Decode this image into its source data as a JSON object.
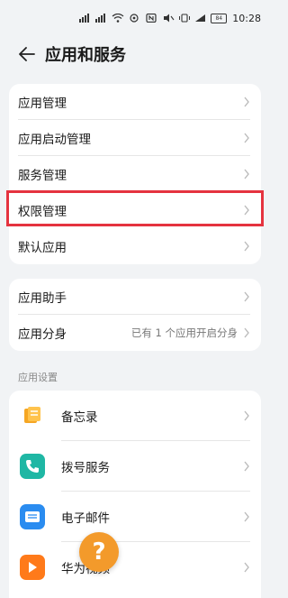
{
  "status_bar": {
    "time": "10:28",
    "battery": "84"
  },
  "header": {
    "title": "应用和服务",
    "back_icon": "arrow-left-icon"
  },
  "group1": {
    "items": [
      {
        "label": "应用管理"
      },
      {
        "label": "应用启动管理"
      },
      {
        "label": "服务管理"
      },
      {
        "label": "权限管理",
        "highlighted": true
      },
      {
        "label": "默认应用"
      }
    ]
  },
  "group2": {
    "items": [
      {
        "label": "应用助手"
      },
      {
        "label": "应用分身",
        "value": "已有 1 个应用开启分身"
      }
    ]
  },
  "app_settings": {
    "section_label": "应用设置",
    "items": [
      {
        "label": "备忘录",
        "icon": "notepad-icon",
        "color": "#f5a623"
      },
      {
        "label": "拨号服务",
        "icon": "phone-icon",
        "color": "#1fb7a4"
      },
      {
        "label": "电子邮件",
        "icon": "mail-icon",
        "color": "#2a8cf0"
      },
      {
        "label": "华为视频",
        "icon": "video-icon",
        "color": "#ff7a1a"
      }
    ]
  },
  "help": {
    "icon": "help-question-icon",
    "symbol": "?"
  },
  "colors": {
    "highlight": "#e5333f",
    "background": "#f1f3f5"
  }
}
